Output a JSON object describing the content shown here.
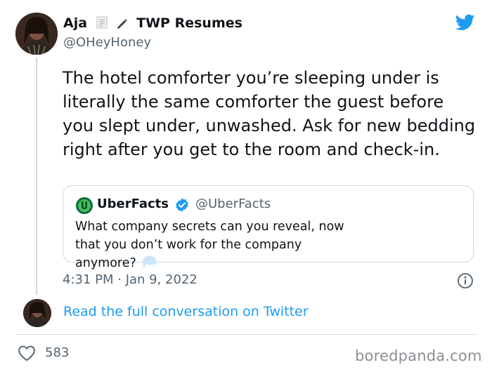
{
  "author": {
    "display_name": "Aja",
    "name_suffix": "TWP Resumes",
    "emoji_icons": [
      "document-icon",
      "pen-icon"
    ],
    "handle": "@OHeyHoney",
    "avatar_icon": "avatar-photo"
  },
  "tweet": {
    "text": "The hotel comforter you’re sleeping under is literally the same comforter the guest before you slept under, unwashed.  Ask for new bedding right after you get to the room and check-in.",
    "timestamp": "4:31 PM · Jan 9, 2022"
  },
  "quoted_tweet": {
    "display_name": "UberFacts",
    "handle": "@UberFacts",
    "text": "What company secrets can you reveal, now that you don’t work for the company anymore?",
    "emoji_icon": "thought-bubble-icon"
  },
  "footer": {
    "read_link": "Read the full conversation on Twitter",
    "like_count": "583",
    "watermark": "boredpanda.com"
  },
  "colors": {
    "twitter_blue": "#1d9bf0",
    "text": "#0f1419",
    "muted": "#536471",
    "border": "#cfd9de",
    "uberfacts_green": "#0b6b3a"
  }
}
